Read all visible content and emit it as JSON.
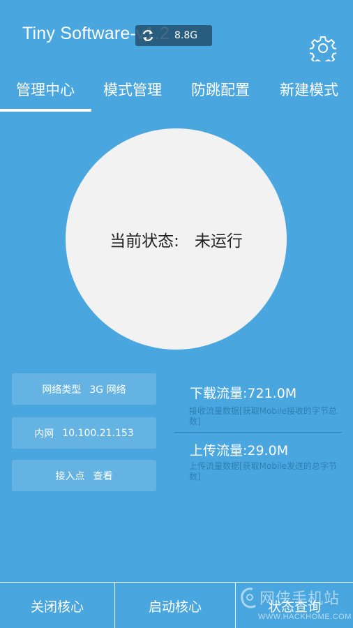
{
  "header": {
    "app_title": "Tiny Software-v1.2",
    "net_badge_speed": "8.8G",
    "settings_icon": "gear-icon",
    "sync_icon": "sync-arrows-icon"
  },
  "tabs": [
    {
      "label": "管理中心",
      "active": true
    },
    {
      "label": "模式管理",
      "active": false
    },
    {
      "label": "防跳配置",
      "active": false
    },
    {
      "label": "新建模式",
      "active": false
    }
  ],
  "status": {
    "label": "当前状态:",
    "value": "未运行"
  },
  "info": {
    "network_type_label": "网络类型",
    "network_type_value": "3G 网络",
    "intranet_label": "内网",
    "intranet_value": "10.100.21.153",
    "apn_label": "接入点",
    "apn_value": "查看"
  },
  "traffic": {
    "download_title": "下载流量:721.0M",
    "download_desc": "接收流量数据[获取Mobile接收的字节总数]",
    "upload_title": "上传流量:29.0M",
    "upload_desc": "上传流量数据[获取Mobile发送的总字节数]"
  },
  "bottom": {
    "close_core": "关闭核心",
    "start_core": "启动核心",
    "status_query": "状态查询"
  },
  "watermark": {
    "text": "网侠手机站",
    "url": "WWW.HACKHOME.COM"
  },
  "colors": {
    "background": "#4aa6df",
    "circle": "#f2f2f2",
    "description_text": "#2f7fb5"
  }
}
